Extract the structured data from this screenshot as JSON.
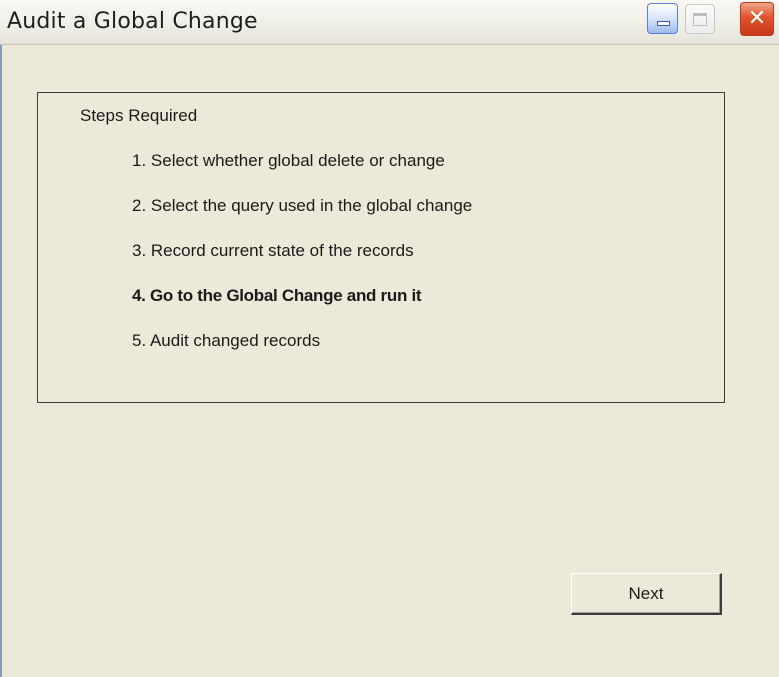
{
  "window": {
    "title": "Audit a Global Change"
  },
  "titlebar_buttons": {
    "minimize_icon": "minimize-icon",
    "maximize_icon": "maximize-icon",
    "close_icon": "close-icon",
    "close_glyph": "✕"
  },
  "steps": {
    "heading": "Steps Required",
    "items": [
      {
        "label": "1. Select whether global delete or change",
        "current": false
      },
      {
        "label": "2. Select the query used in the global change",
        "current": false
      },
      {
        "label": "3. Record current state of the records",
        "current": false
      },
      {
        "label": "4. Go to the Global Change and run it",
        "current": true
      },
      {
        "label": "5. Audit changed records",
        "current": false
      }
    ]
  },
  "actions": {
    "next_label": "Next"
  },
  "colors": {
    "window_bg": "#ece9d8",
    "close_button": "#e2532c",
    "minimize_button": "#9fb9ef"
  }
}
